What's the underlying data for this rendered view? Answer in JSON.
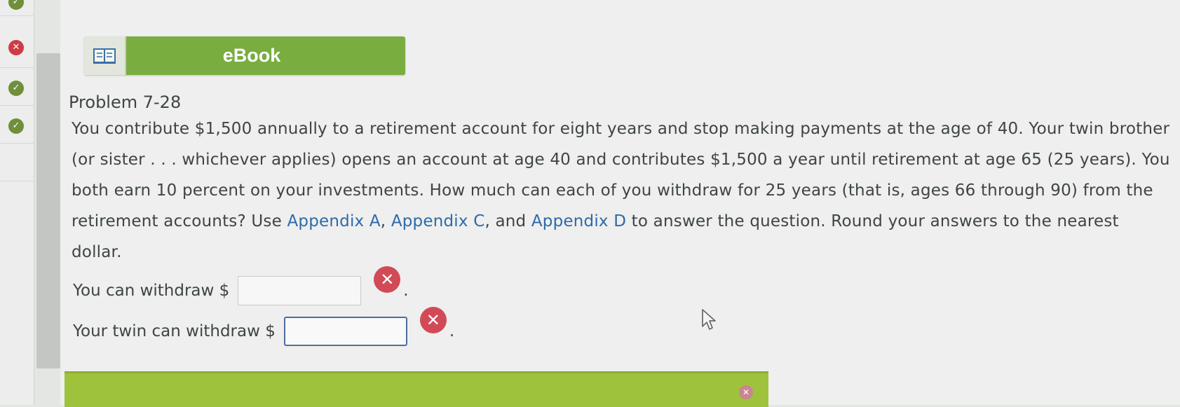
{
  "sidebar": {
    "items": [
      {
        "status": "correct",
        "icon": "check-icon",
        "glyph": "✓"
      },
      {
        "status": "incorrect",
        "icon": "x-icon",
        "glyph": "✕"
      },
      {
        "status": "correct",
        "icon": "check-icon",
        "glyph": "✓"
      },
      {
        "status": "correct",
        "icon": "check-icon",
        "glyph": "✓"
      },
      {
        "status": "correct",
        "icon": "check-icon",
        "glyph": "✓"
      }
    ]
  },
  "ebook": {
    "label": "eBook",
    "icon": "book-icon"
  },
  "problem": {
    "title": "Problem 7-28",
    "text_part1": "You contribute $1,500 annually to a retirement account for eight years and stop making payments at the age of 40. Your twin brother (or sister . . . whichever applies) opens an account at age 40 and contributes $1,500 a year until retirement at age 65 (25 years). You both earn 10 percent on your investments. How much can each of you withdraw for 25 years (that is, ages 66 through 90) from the retirement accounts? Use ",
    "link_a": "Appendix A",
    "sep1": ", ",
    "link_c": "Appendix C",
    "sep2": ", and ",
    "link_d": "Appendix D",
    "text_part2": " to answer the question. Round your answers to the nearest dollar."
  },
  "answers": [
    {
      "label": "You can withdraw $",
      "value": "",
      "status_icon": "error-icon",
      "glyph": "✕",
      "suffix": "."
    },
    {
      "label": "Your twin can withdraw $",
      "value": "",
      "status_icon": "error-icon",
      "glyph": "✕",
      "suffix": "."
    }
  ],
  "feedback_bar": {
    "close_glyph": "✕"
  },
  "colors": {
    "accent_green": "#79ad3f",
    "error_red": "#d24a56",
    "link_blue": "#2e6aa8",
    "feedback_green": "#9fc23c"
  }
}
